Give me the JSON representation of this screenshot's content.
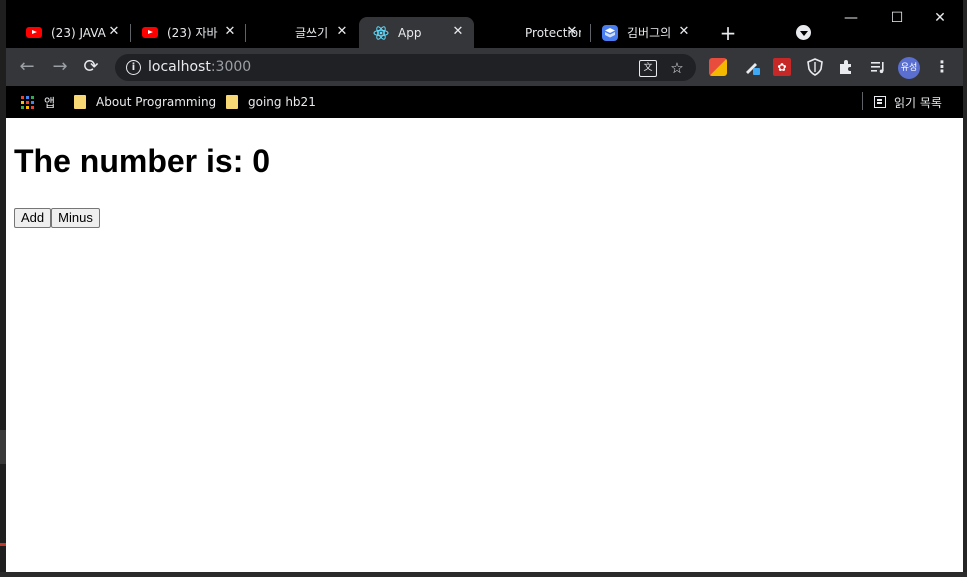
{
  "browser": {
    "tabs": [
      {
        "title": "(23) JAVA",
        "favicon": "youtube-icon",
        "active": false
      },
      {
        "title": "(23) 자바",
        "favicon": "youtube-icon",
        "active": false
      },
      {
        "title": "글쓰기",
        "favicon": "",
        "active": false
      },
      {
        "title": "App",
        "favicon": "react-icon",
        "active": true
      },
      {
        "title": "Protection",
        "favicon": "",
        "active": false
      },
      {
        "title": "김버그의",
        "favicon": "cube-icon",
        "active": false
      }
    ],
    "new_tab": "+",
    "close_glyph": "✕",
    "window_controls": {
      "minimize": "—",
      "maximize": "☐",
      "close": "✕"
    }
  },
  "toolbar": {
    "url_host": "localhost",
    "url_port": ":3000",
    "profile_initials": "유성"
  },
  "bookmarks": {
    "apps_label": "앱",
    "items": [
      "About Programming",
      "going hb21"
    ],
    "reading_list": "읽기 목록"
  },
  "page": {
    "heading": "The number is: 0",
    "add_label": "Add",
    "minus_label": "Minus"
  },
  "colors": {
    "tab_active": "#35363a",
    "chrome_bg": "#000000",
    "youtube_red": "#ff0000",
    "react_blue": "#61dafb",
    "folder_yellow": "#f8d775"
  }
}
